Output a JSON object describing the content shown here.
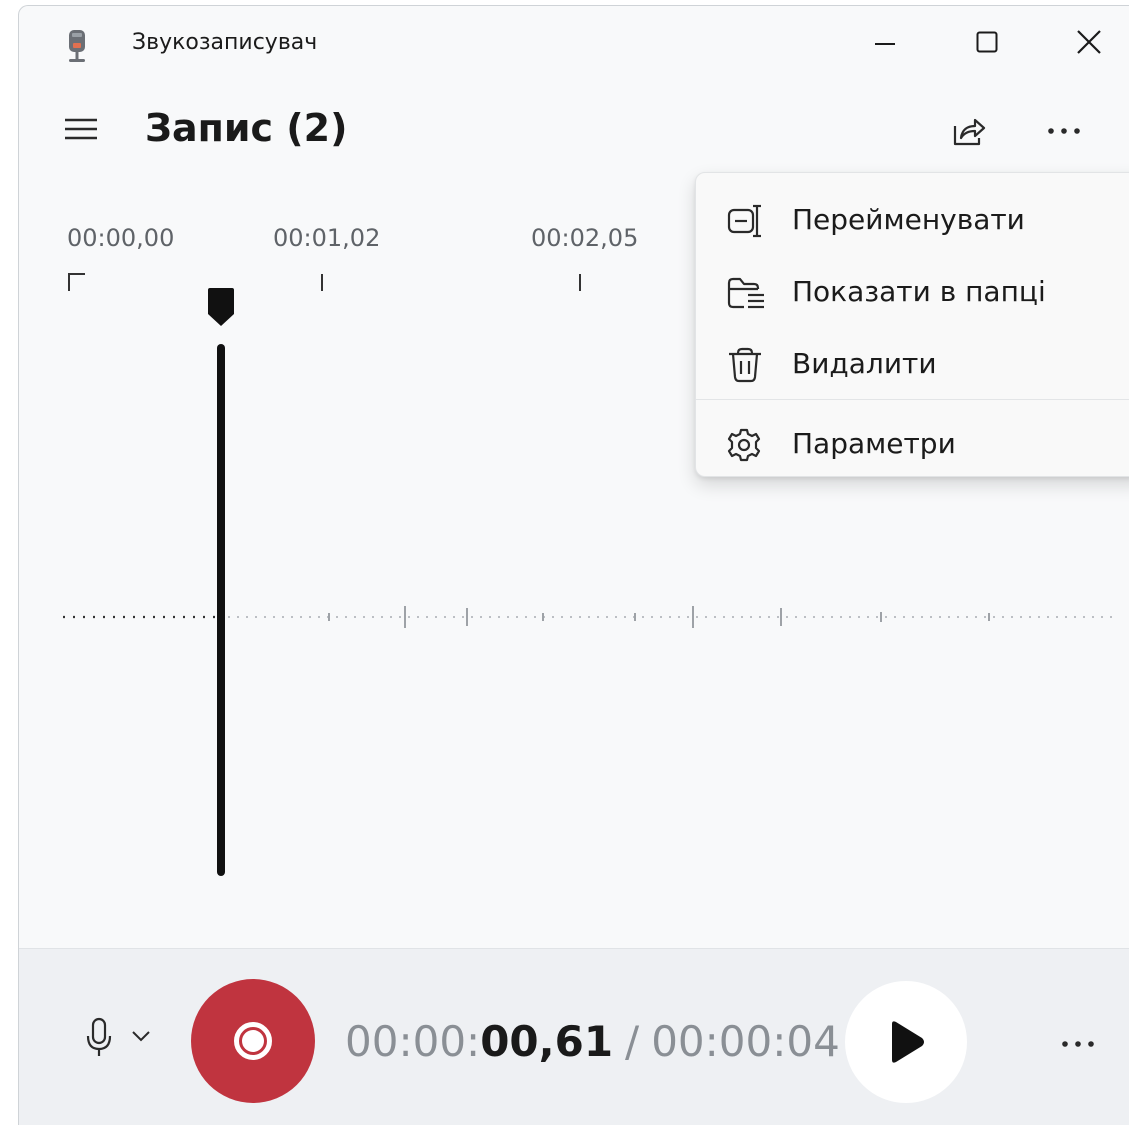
{
  "window": {
    "title": "Звукозаписувач",
    "icons": {
      "app": "microphone-app-icon",
      "minimize": "minimize-icon",
      "maximize": "maximize-icon",
      "close": "close-icon"
    }
  },
  "header": {
    "title": "Запис (2)",
    "icons": {
      "menu": "hamburger-icon",
      "share": "share-icon",
      "more": "more-icon"
    }
  },
  "timeline": {
    "labels": [
      "00:00,00",
      "00:01,02",
      "00:02,05"
    ]
  },
  "context_menu": {
    "items": [
      {
        "label": "Перейменувати",
        "icon": "rename-icon"
      },
      {
        "label": "Показати в папці",
        "icon": "folder-icon"
      },
      {
        "label": "Видалити",
        "icon": "trash-icon"
      },
      {
        "label": "Параметри",
        "icon": "gear-icon"
      }
    ]
  },
  "player": {
    "current_prefix": "00:00:",
    "current_bold": "00,61",
    "separator": "/",
    "total": "00:00:04",
    "icons": {
      "mic": "microphone-icon",
      "dropdown": "chevron-down-icon",
      "record": "record-icon",
      "play": "play-icon",
      "more": "more-icon"
    },
    "colors": {
      "record": "#c0343f"
    }
  }
}
